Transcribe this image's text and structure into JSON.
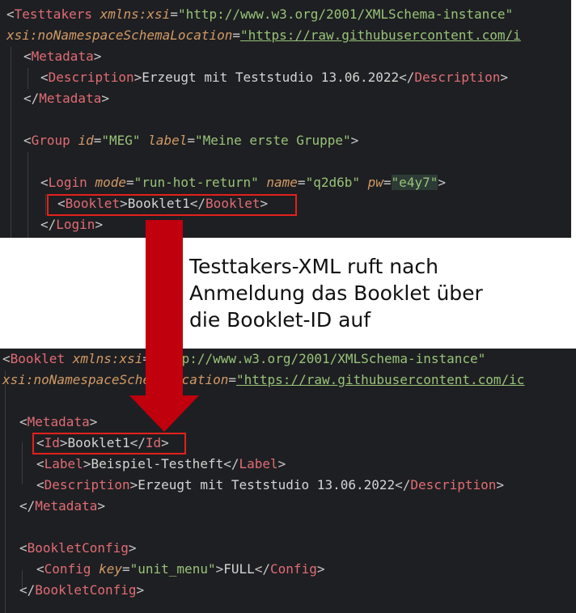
{
  "top_panel": {
    "lines": [
      {
        "id": "t1",
        "indent": 0,
        "tokens": [
          [
            "br",
            "<"
          ],
          [
            "tag",
            "Testtakers"
          ],
          [
            "txt",
            " "
          ],
          [
            "attr",
            "xmlns:xsi"
          ],
          [
            "br",
            "="
          ],
          [
            "str",
            "\"http://www.w3.org/2001/XMLSchema-instance\""
          ]
        ]
      },
      {
        "id": "t2",
        "indent": 0,
        "tokens": [
          [
            "attr",
            "xsi:noNamespaceSchemaLocation"
          ],
          [
            "br",
            "="
          ],
          [
            "url",
            "\"https://raw.githubusercontent.com/i"
          ]
        ]
      },
      {
        "id": "t3",
        "indent": 1,
        "tokens": [
          [
            "br",
            "<"
          ],
          [
            "tag",
            "Metadata"
          ],
          [
            "br",
            ">"
          ]
        ]
      },
      {
        "id": "t4",
        "indent": 2,
        "tokens": [
          [
            "br",
            "<"
          ],
          [
            "tag",
            "Description"
          ],
          [
            "br",
            ">"
          ],
          [
            "txt",
            "Erzeugt mit Teststudio 13.06.2022"
          ],
          [
            "br",
            "</"
          ],
          [
            "tag",
            "Description"
          ],
          [
            "br",
            ">"
          ]
        ]
      },
      {
        "id": "t5",
        "indent": 1,
        "tokens": [
          [
            "br",
            "</"
          ],
          [
            "tag",
            "Metadata"
          ],
          [
            "br",
            ">"
          ]
        ]
      },
      {
        "id": "t6",
        "indent": 0,
        "tokens": []
      },
      {
        "id": "t7",
        "indent": 1,
        "tokens": [
          [
            "br",
            "<"
          ],
          [
            "tag",
            "Group"
          ],
          [
            "txt",
            " "
          ],
          [
            "attr",
            "id"
          ],
          [
            "br",
            "="
          ],
          [
            "str",
            "\"MEG\""
          ],
          [
            "txt",
            " "
          ],
          [
            "attr",
            "label"
          ],
          [
            "br",
            "="
          ],
          [
            "str",
            "\"Meine erste Gruppe\""
          ],
          [
            "br",
            ">"
          ]
        ]
      },
      {
        "id": "t8",
        "indent": 0,
        "tokens": []
      },
      {
        "id": "t9",
        "indent": 2,
        "tokens": [
          [
            "br",
            "<"
          ],
          [
            "tag",
            "Login"
          ],
          [
            "txt",
            " "
          ],
          [
            "attr",
            "mode"
          ],
          [
            "br",
            "="
          ],
          [
            "str",
            "\"run-hot-return\""
          ],
          [
            "txt",
            " "
          ],
          [
            "attr",
            "name"
          ],
          [
            "br",
            "="
          ],
          [
            "str",
            "\"q2d6b\""
          ],
          [
            "txt",
            " "
          ],
          [
            "attr",
            "pw"
          ],
          [
            "br",
            "="
          ],
          [
            "str",
            "\"e4y7\""
          ],
          [
            "br",
            ">"
          ]
        ]
      },
      {
        "id": "t10",
        "indent": 3,
        "tokens": [
          [
            "br",
            "<"
          ],
          [
            "tag",
            "Booklet"
          ],
          [
            "br",
            ">"
          ],
          [
            "txt",
            "Booklet1"
          ],
          [
            "br",
            "</"
          ],
          [
            "tag",
            "Booklet"
          ],
          [
            "br",
            ">"
          ]
        ]
      },
      {
        "id": "t11",
        "indent": 2,
        "tokens": [
          [
            "br",
            "</"
          ],
          [
            "tag",
            "Login"
          ],
          [
            "br",
            ">"
          ]
        ]
      }
    ]
  },
  "bottom_panel": {
    "lines": [
      {
        "id": "b1",
        "indent": 0,
        "tokens": [
          [
            "br",
            "<"
          ],
          [
            "tag",
            "Booklet"
          ],
          [
            "txt",
            " "
          ],
          [
            "attr",
            "xmlns:xsi"
          ],
          [
            "br",
            "="
          ],
          [
            "str",
            "\"http://www.w3.org/2001/XMLSchema-instance\""
          ]
        ]
      },
      {
        "id": "b2",
        "indent": 0,
        "tokens": [
          [
            "attr",
            "xsi:noNamespaceSchemaLocation"
          ],
          [
            "br",
            "="
          ],
          [
            "url",
            "\"https://raw.githubusercontent.com/ic"
          ]
        ]
      },
      {
        "id": "b3",
        "indent": 0,
        "tokens": []
      },
      {
        "id": "b4",
        "indent": 1,
        "tokens": [
          [
            "br",
            "<"
          ],
          [
            "tag",
            "Metadata"
          ],
          [
            "br",
            ">"
          ]
        ]
      },
      {
        "id": "b5",
        "indent": 2,
        "tokens": [
          [
            "br",
            "<"
          ],
          [
            "tag",
            "Id"
          ],
          [
            "br",
            ">"
          ],
          [
            "txt",
            "Booklet1"
          ],
          [
            "br",
            "</"
          ],
          [
            "tag",
            "Id"
          ],
          [
            "br",
            ">"
          ]
        ]
      },
      {
        "id": "b6",
        "indent": 2,
        "tokens": [
          [
            "br",
            "<"
          ],
          [
            "tag",
            "Label"
          ],
          [
            "br",
            ">"
          ],
          [
            "txt",
            "Beispiel-Testheft"
          ],
          [
            "br",
            "</"
          ],
          [
            "tag",
            "Label"
          ],
          [
            "br",
            ">"
          ]
        ]
      },
      {
        "id": "b7",
        "indent": 2,
        "tokens": [
          [
            "br",
            "<"
          ],
          [
            "tag",
            "Description"
          ],
          [
            "br",
            ">"
          ],
          [
            "txt",
            "Erzeugt mit Teststudio 13.06.2022"
          ],
          [
            "br",
            "</"
          ],
          [
            "tag",
            "Description"
          ],
          [
            "br",
            ">"
          ]
        ]
      },
      {
        "id": "b8",
        "indent": 1,
        "tokens": [
          [
            "br",
            "</"
          ],
          [
            "tag",
            "Metadata"
          ],
          [
            "br",
            ">"
          ]
        ]
      },
      {
        "id": "b9",
        "indent": 0,
        "tokens": []
      },
      {
        "id": "b10",
        "indent": 1,
        "tokens": [
          [
            "br",
            "<"
          ],
          [
            "tag",
            "BookletConfig"
          ],
          [
            "br",
            ">"
          ]
        ]
      },
      {
        "id": "b11",
        "indent": 2,
        "tokens": [
          [
            "br",
            "<"
          ],
          [
            "tag",
            "Config"
          ],
          [
            "txt",
            " "
          ],
          [
            "attr",
            "key"
          ],
          [
            "br",
            "="
          ],
          [
            "str",
            "\"unit_menu\""
          ],
          [
            "br",
            ">"
          ],
          [
            "txt",
            "FULL"
          ],
          [
            "br",
            "</"
          ],
          [
            "tag",
            "Config"
          ],
          [
            "br",
            ">"
          ]
        ]
      },
      {
        "id": "b12",
        "indent": 1,
        "tokens": [
          [
            "br",
            "</"
          ],
          [
            "tag",
            "BookletConfig"
          ],
          [
            "br",
            ">"
          ]
        ]
      }
    ]
  },
  "caption": {
    "line1": "Testtakers-XML ruft nach",
    "line2": "Anmeldung das Booklet über",
    "line3": "die Booklet-ID auf"
  },
  "colors": {
    "editor_bg": "#1e1f22",
    "tag": "#e06c75",
    "attribute": "#d19a66",
    "string": "#98c379",
    "text": "#d4d4d4",
    "highlight_box": "#e3211c",
    "arrow": "#c0000c"
  }
}
